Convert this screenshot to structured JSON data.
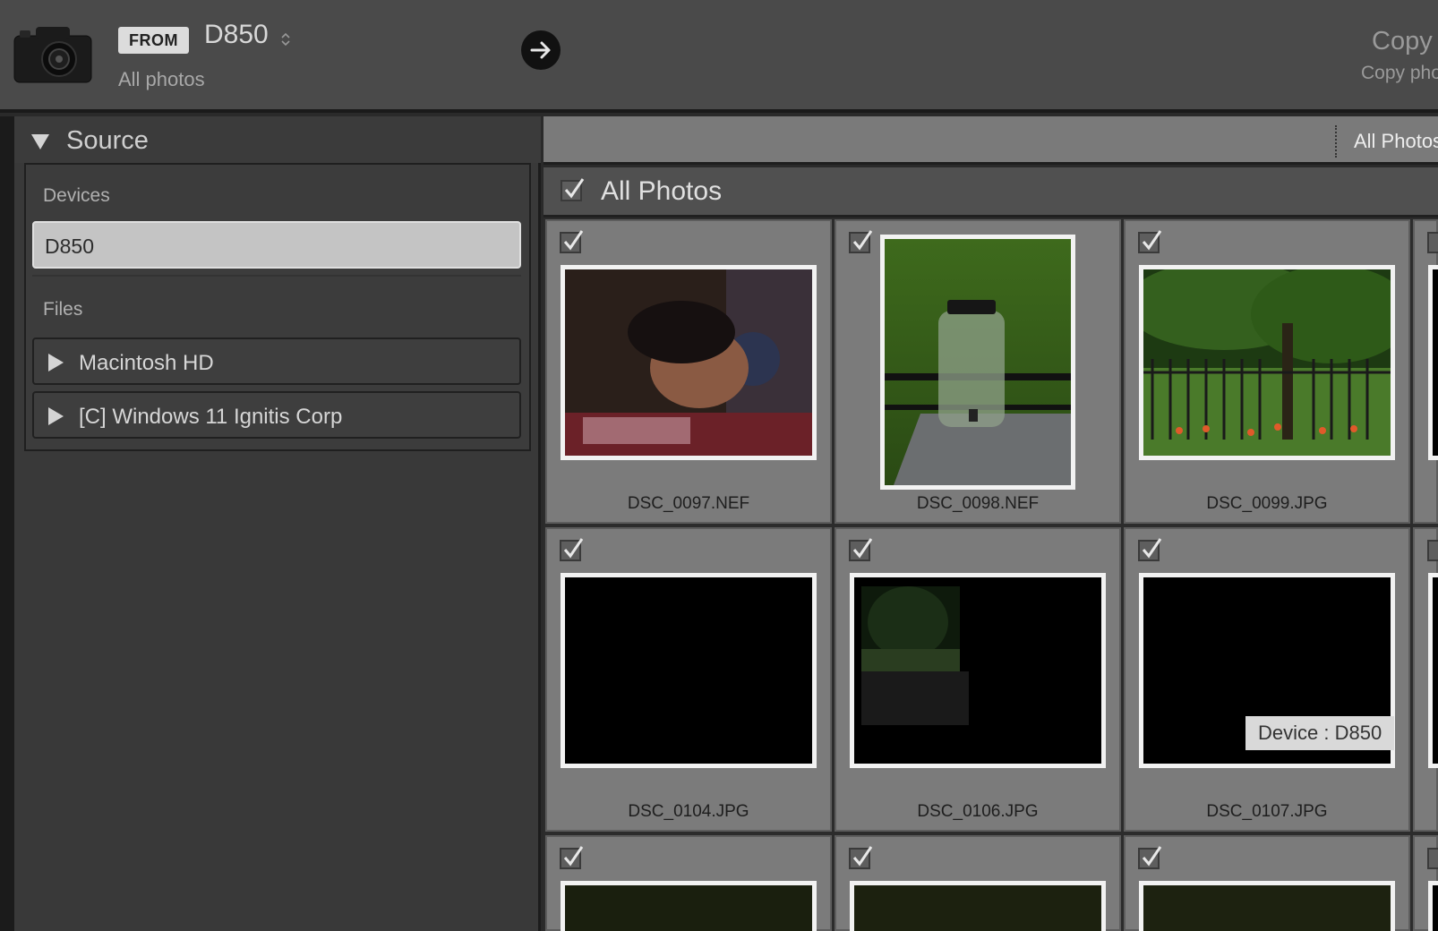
{
  "header": {
    "from_badge": "FROM",
    "device": "D850",
    "source_sub": "All photos",
    "copy_title": "Copy",
    "copy_sub": "Copy pho"
  },
  "source_panel": {
    "title": "Source",
    "devices_label": "Devices",
    "device_item": "D850",
    "files_label": "Files",
    "files": [
      {
        "label": "Macintosh HD"
      },
      {
        "label": "[C] Windows 11 Ignitis Corp"
      }
    ]
  },
  "grid": {
    "toolbar_label": "All Photos",
    "header_title": "All Photos",
    "files": [
      {
        "name": "DSC_0097.NEF"
      },
      {
        "name": "DSC_0098.NEF"
      },
      {
        "name": "DSC_0099.JPG"
      },
      {
        "name": "DSC_0104.JPG"
      },
      {
        "name": "DSC_0106.JPG"
      },
      {
        "name": "DSC_0107.JPG"
      }
    ],
    "tooltip": "Device : D850"
  }
}
